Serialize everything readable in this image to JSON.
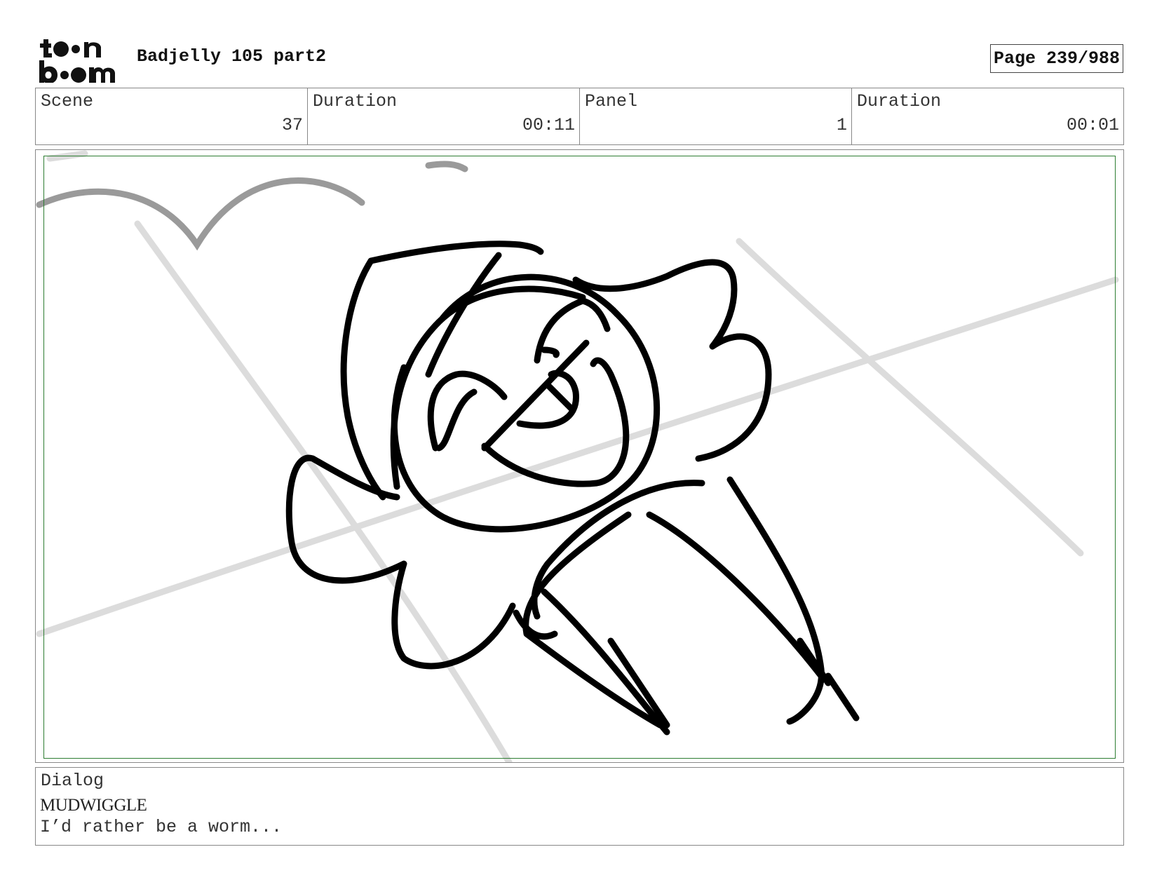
{
  "header": {
    "logo_icon": "toon-boom-logo",
    "title": "Badjelly 105 part2",
    "page": "Page 239/988"
  },
  "info": [
    {
      "label": "Scene",
      "value": "37"
    },
    {
      "label": "Duration",
      "value": "00:11"
    },
    {
      "label": "Panel",
      "value": "1"
    },
    {
      "label": "Duration",
      "value": "00:01"
    }
  ],
  "frame": {
    "safe_area_color": "#2e7d32"
  },
  "dialog": {
    "label": "Dialog",
    "speaker": "MUDWIGGLE",
    "line": "I’d rather be a worm..."
  }
}
